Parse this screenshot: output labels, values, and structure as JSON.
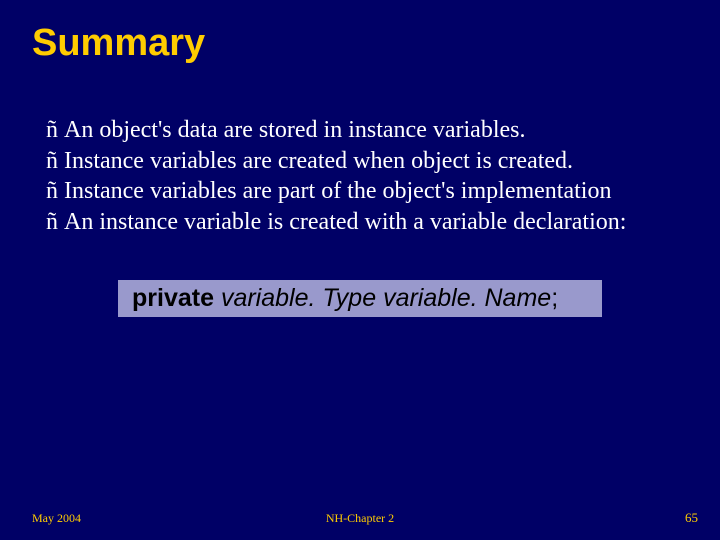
{
  "title": "Summary",
  "bullets": {
    "glyph": "ñ",
    "items": [
      "An object's data are stored in instance variables.",
      "Instance variables are created when object is created.",
      "Instance variables are part of the object's implementation",
      "An instance variable is created with a variable declaration:"
    ]
  },
  "code": {
    "keyword": "private",
    "type": "variable. Type",
    "name": "variable. Name",
    "terminator": ";"
  },
  "footer": {
    "left": "May 2004",
    "center": "NH-Chapter 2",
    "right": "65"
  }
}
